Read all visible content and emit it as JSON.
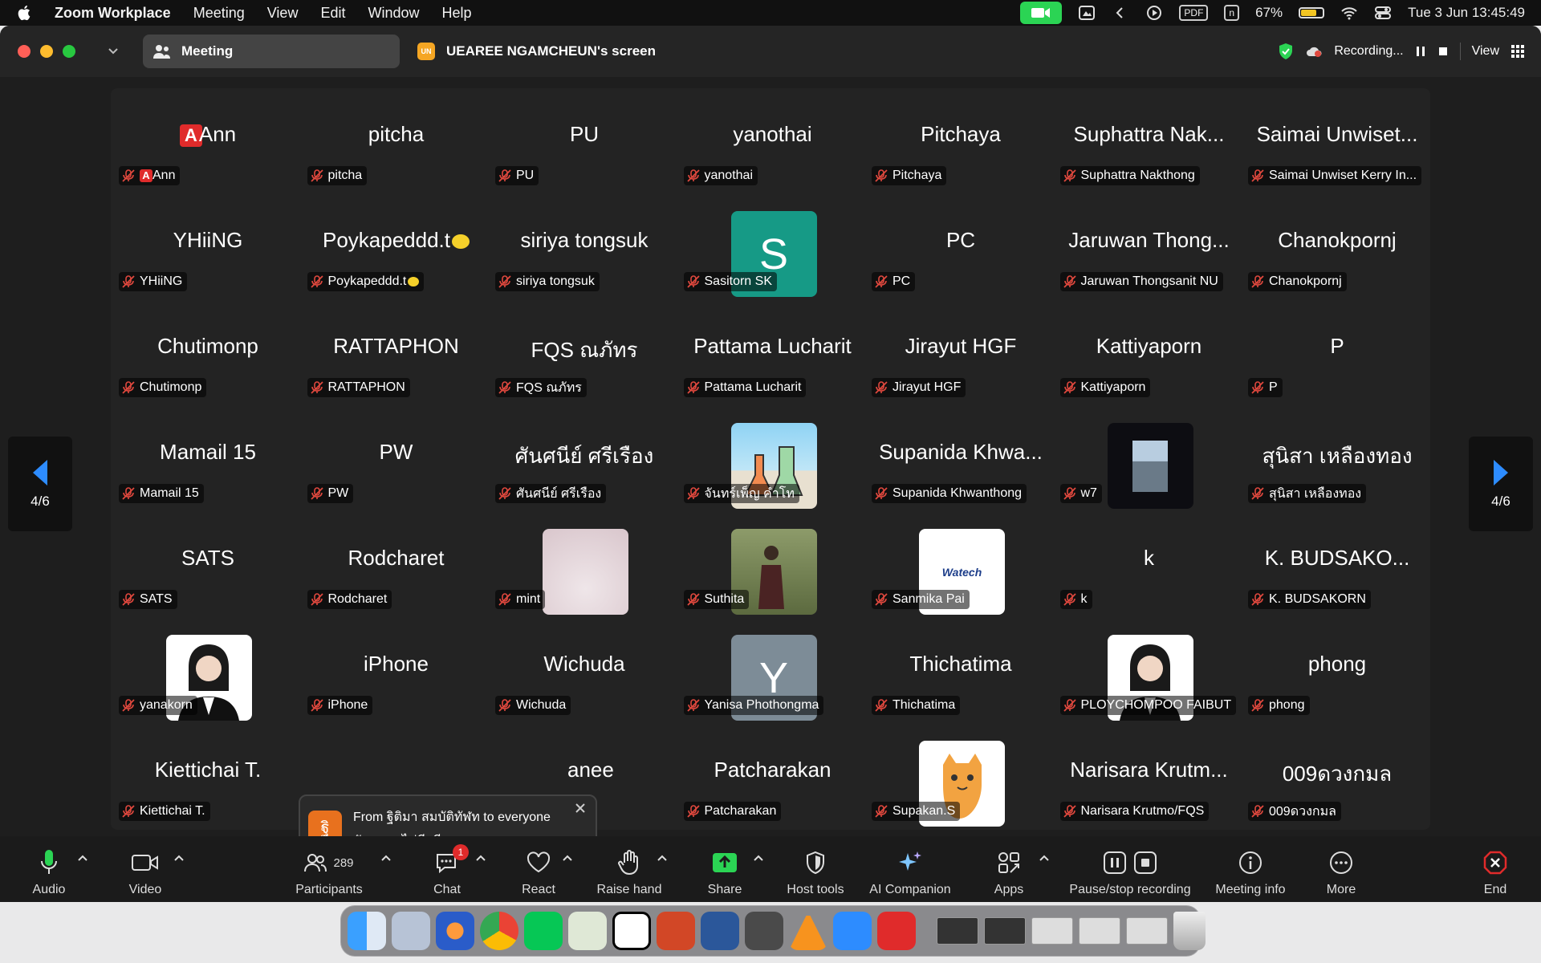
{
  "menubar": {
    "app": "Zoom Workplace",
    "items": [
      "Meeting",
      "View",
      "Edit",
      "Window",
      "Help"
    ],
    "battery_pct": "67%",
    "battery_level": 0.67,
    "pdf": "PDF",
    "n_icon": "n",
    "datetime": "Tue 3 Jun  13:45:49"
  },
  "window": {
    "tab_meeting": "Meeting",
    "screen_badge": "UN",
    "screen_tab": "UEAREE NGAMCHEUN's screen",
    "recording": "Recording...",
    "view": "View"
  },
  "gallery": {
    "page_left": "4/6",
    "page_right": "4/6",
    "tiles": [
      {
        "big": "Ann",
        "label": "Ann",
        "icon_a": true
      },
      {
        "big": "pitcha",
        "label": "pitcha"
      },
      {
        "big": "PU",
        "label": "PU"
      },
      {
        "big": "yanothai",
        "label": "yanothai"
      },
      {
        "big": "Pitchaya",
        "label": "Pitchaya"
      },
      {
        "big": "Suphattra  Nak...",
        "label": "Suphattra  Nakthong"
      },
      {
        "big": "Saimai Unwiset...",
        "label": "Saimai Unwiset Kerry In..."
      },
      {
        "big": "YHiiNG",
        "label": "YHiiNG"
      },
      {
        "big": "Poykapeddd.t",
        "label": "Poykapeddd.t",
        "lemon": true
      },
      {
        "big": "siriya tongsuk",
        "label": "siriya tongsuk"
      },
      {
        "big": "",
        "label": "Sasitorn SK",
        "avatar": "letter",
        "letter": "S",
        "color": "#169a86"
      },
      {
        "big": "PC",
        "label": "PC"
      },
      {
        "big": "Jaruwan Thong...",
        "label": "Jaruwan Thongsanit NU"
      },
      {
        "big": "Chanokpornj",
        "label": "Chanokpornj"
      },
      {
        "big": "Chutimonp",
        "label": "Chutimonp"
      },
      {
        "big": "RATTAPHON",
        "label": "RATTAPHON"
      },
      {
        "big": "FQS ณภัทร",
        "label": "FQS ณภัทร"
      },
      {
        "big": "Pattama Lucharit",
        "label": "Pattama Lucharit"
      },
      {
        "big": "Jirayut HGF",
        "label": "Jirayut HGF"
      },
      {
        "big": "Kattiyaporn",
        "label": "Kattiyaporn"
      },
      {
        "big": "P",
        "label": "P"
      },
      {
        "big": "Mamail 15",
        "label": "Mamail 15"
      },
      {
        "big": "PW",
        "label": "PW"
      },
      {
        "big": "ศันศนีย์ ศรีเรือง",
        "label": "ศันศนีย์ ศรีเรือง"
      },
      {
        "big": "",
        "label": "จันทร์เพ็ญ คำโท",
        "avatar": "lab"
      },
      {
        "big": "Supanida Khwa...",
        "label": "Supanida Khwanthong"
      },
      {
        "big": "",
        "label": "w7",
        "avatar": "window"
      },
      {
        "big": "สุนิสา เหลืองทอง",
        "label": "สุนิสา เหลืองทอง"
      },
      {
        "big": "SATS",
        "label": "SATS"
      },
      {
        "big": "Rodcharet",
        "label": "Rodcharet"
      },
      {
        "big": "",
        "label": "mint",
        "avatar": "pink"
      },
      {
        "big": "",
        "label": "Suthita",
        "avatar": "person-garden"
      },
      {
        "big": "",
        "label": "Sanmika Pai",
        "avatar": "watech",
        "logo_text": "Watech"
      },
      {
        "big": "k",
        "label": "k"
      },
      {
        "big": "K. BUDSAKO...",
        "label": "K. BUDSAKORN"
      },
      {
        "big": "",
        "label": "yanakorn",
        "avatar": "portrait"
      },
      {
        "big": "iPhone",
        "label": "iPhone"
      },
      {
        "big": "Wichuda",
        "label": "Wichuda"
      },
      {
        "big": "",
        "label": "Yanisa Phothongma",
        "avatar": "letter",
        "letter": "Y",
        "color": "#7d8c97"
      },
      {
        "big": "Thichatima",
        "label": "Thichatima"
      },
      {
        "big": "",
        "label": "PLOYCHOMPOO FAIBUT",
        "avatar": "portrait"
      },
      {
        "big": "phong",
        "label": "phong"
      },
      {
        "big": "Kiettichai T.",
        "label": "Kiettichai T."
      },
      {
        "big": "",
        "label": "",
        "hidden": true
      },
      {
        "big": "anee",
        "label": "",
        "partial": true
      },
      {
        "big": "Patcharakan",
        "label": "Patcharakan"
      },
      {
        "big": "",
        "label": "Supakan.S",
        "avatar": "cat"
      },
      {
        "big": "Narisara Krutm...",
        "label": "Narisara Krutmo/FQS"
      },
      {
        "big": "009ดวงกมล",
        "label": "009ดวงกมล"
      }
    ]
  },
  "toast": {
    "avatar_letter": "ฐิ",
    "line1": "From ฐิติมา สมบัติทัฬท to everyone",
    "line2": "สัญญาณไม่ดี เสียงขาดๆหายๆ"
  },
  "toolbar": {
    "audio": "Audio",
    "video": "Video",
    "participants": "Participants",
    "participants_count": "289",
    "chat": "Chat",
    "chat_badge": "1",
    "react": "React",
    "raise_hand": "Raise hand",
    "share": "Share",
    "host_tools": "Host tools",
    "ai_companion": "AI Companion",
    "apps": "Apps",
    "pause_recording": "Pause/stop recording",
    "meeting_info": "Meeting info",
    "more": "More",
    "end": "End"
  },
  "colors": {
    "accent_green": "#2bd454",
    "mute_red": "#e0483e",
    "arrow_blue": "#2d8cff",
    "end_red": "#e02b2b"
  }
}
